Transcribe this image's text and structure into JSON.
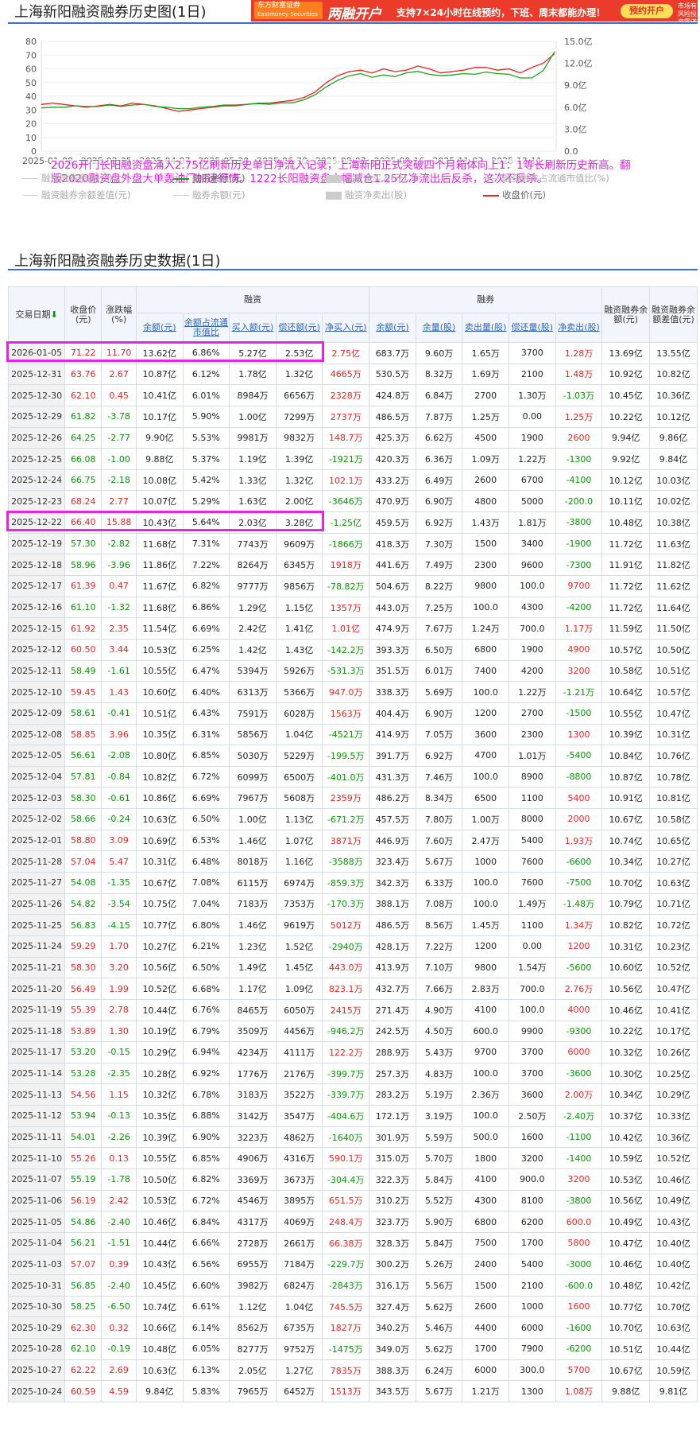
{
  "title": "上海新阳融资融券历史图(1日)",
  "ad": {
    "logo": "东方财富证券",
    "logo_sub": "Eastmoney Securities",
    "big": "两融开户",
    "text": "支持7×24小时在线预约，下班、周末都能办理！",
    "button": "预约开户",
    "mini": "市场有风险投资需谨慎"
  },
  "annotation": "2026开门长阳融资盘涌入2.75亿刷新历史单日净流入记录，上海新阳正式突破四个月箱体向上1：1等长刷新历史新高。翻版2020融资盘外盘大单轰油门加速行情。1222长阳融资盘大幅减仓1.25亿净流出后反杀，这次不反杀。",
  "section_title": "上海新阳融资融券历史数据(1日)",
  "legend": [
    "融资融券余额(元)",
    "融资余额(元)",
    "融资净买入(元)",
    "融资融券占流通市值比(%)",
    "融资融券余额差值(元)",
    "融券余额(元)",
    "融资净卖出(股)",
    "收盘价(元)"
  ],
  "headers": {
    "date": "交易日期",
    "close": "收盘价(元)",
    "chg": "涨跌幅(%)",
    "rz": "融资",
    "rq": "融券",
    "rzrq": "融资融券余额(元)",
    "diff": "融资融券余额差值(元)",
    "rz_bal": "余额(元)",
    "rz_pct": "余额占流通市值比",
    "rz_buy": "买入额(元)",
    "rz_repay": "偿还额(元)",
    "rz_net": "净买入(元)",
    "rq_bal": "余额(元)",
    "rq_vol": "余量(股)",
    "rq_sell": "卖出量(股)",
    "rq_repay": "偿还量(股)",
    "rq_net": "净卖出(股)"
  },
  "rows": [
    [
      "2026-01-05",
      "71.22",
      "11.70",
      "13.62亿",
      "6.86%",
      "5.27亿",
      "2.53亿",
      "2.75亿",
      "683.7万",
      "9.60万",
      "1.65万",
      "3700",
      "1.28万",
      "13.69亿",
      "13.55亿"
    ],
    [
      "2025-12-31",
      "63.76",
      "2.67",
      "10.87亿",
      "6.12%",
      "1.78亿",
      "1.32亿",
      "4665万",
      "530.5万",
      "8.32万",
      "1.69万",
      "2100",
      "1.48万",
      "10.92亿",
      "10.82亿"
    ],
    [
      "2025-12-30",
      "62.10",
      "0.45",
      "10.41亿",
      "6.01%",
      "8984万",
      "6656万",
      "2328万",
      "424.8万",
      "6.84万",
      "2700",
      "1.30万",
      "-1.03万",
      "10.45亿",
      "10.36亿"
    ],
    [
      "2025-12-29",
      "61.82",
      "-3.78",
      "10.17亿",
      "5.90%",
      "1.00亿",
      "7299万",
      "2737万",
      "486.5万",
      "7.87万",
      "1.25万",
      "0.00",
      "1.25万",
      "10.22亿",
      "10.12亿"
    ],
    [
      "2025-12-26",
      "64.25",
      "-2.77",
      "9.90亿",
      "5.53%",
      "9981万",
      "9832万",
      "148.7万",
      "425.3万",
      "6.62万",
      "4500",
      "1900",
      "2600",
      "9.94亿",
      "9.86亿"
    ],
    [
      "2025-12-25",
      "66.08",
      "-1.00",
      "9.88亿",
      "5.37%",
      "1.19亿",
      "1.39亿",
      "-1921万",
      "420.3万",
      "6.36万",
      "1.09万",
      "1.22万",
      "-1300",
      "9.92亿",
      "9.84亿"
    ],
    [
      "2025-12-24",
      "66.75",
      "-2.18",
      "10.08亿",
      "5.42%",
      "1.33亿",
      "1.32亿",
      "102.1万",
      "433.2万",
      "6.49万",
      "2600",
      "6700",
      "-4100",
      "10.12亿",
      "10.03亿"
    ],
    [
      "2025-12-23",
      "68.24",
      "2.77",
      "10.07亿",
      "5.29%",
      "1.63亿",
      "2.00亿",
      "-3646万",
      "470.9万",
      "6.90万",
      "4800",
      "5000",
      "-200.0",
      "10.11亿",
      "10.02亿"
    ],
    [
      "2025-12-22",
      "66.40",
      "15.88",
      "10.43亿",
      "5.64%",
      "2.03亿",
      "3.28亿",
      "-1.25亿",
      "459.5万",
      "6.92万",
      "1.43万",
      "1.81万",
      "-3800",
      "10.48亿",
      "10.38亿"
    ],
    [
      "2025-12-19",
      "57.30",
      "-2.82",
      "11.68亿",
      "7.31%",
      "7743万",
      "9609万",
      "-1866万",
      "418.3万",
      "7.30万",
      "1500",
      "3400",
      "-1900",
      "11.72亿",
      "11.63亿"
    ],
    [
      "2025-12-18",
      "58.96",
      "-3.96",
      "11.86亿",
      "7.22%",
      "8264万",
      "6345万",
      "1918万",
      "441.6万",
      "7.49万",
      "2300",
      "9600",
      "-7300",
      "11.91亿",
      "11.82亿"
    ],
    [
      "2025-12-17",
      "61.39",
      "0.47",
      "11.67亿",
      "6.82%",
      "9777万",
      "9856万",
      "-78.82万",
      "504.6万",
      "8.22万",
      "9800",
      "100.0",
      "9700",
      "11.72亿",
      "11.62亿"
    ],
    [
      "2025-12-16",
      "61.10",
      "-1.32",
      "11.68亿",
      "6.86%",
      "1.29亿",
      "1.15亿",
      "1357万",
      "443.0万",
      "7.25万",
      "100.0",
      "4300",
      "-4200",
      "11.72亿",
      "11.64亿"
    ],
    [
      "2025-12-15",
      "61.92",
      "2.35",
      "11.54亿",
      "6.69%",
      "2.42亿",
      "1.41亿",
      "1.01亿",
      "474.9万",
      "7.67万",
      "1.24万",
      "700.0",
      "1.17万",
      "11.59亿",
      "11.50亿"
    ],
    [
      "2025-12-12",
      "60.50",
      "3.44",
      "10.53亿",
      "6.25%",
      "1.42亿",
      "1.43亿",
      "-142.2万",
      "393.3万",
      "6.50万",
      "6800",
      "1900",
      "4900",
      "10.57亿",
      "10.50亿"
    ],
    [
      "2025-12-11",
      "58.49",
      "-1.61",
      "10.55亿",
      "6.47%",
      "5394万",
      "5926万",
      "-531.3万",
      "351.5万",
      "6.01万",
      "7400",
      "4200",
      "3200",
      "10.58亿",
      "10.51亿"
    ],
    [
      "2025-12-10",
      "59.45",
      "1.43",
      "10.60亿",
      "6.40%",
      "6313万",
      "5366万",
      "947.0万",
      "338.3万",
      "5.69万",
      "100.0",
      "1.22万",
      "-1.21万",
      "10.64亿",
      "10.57亿"
    ],
    [
      "2025-12-09",
      "58.61",
      "-0.41",
      "10.51亿",
      "6.43%",
      "7591万",
      "6028万",
      "1563万",
      "404.4万",
      "6.90万",
      "1200",
      "2700",
      "-1500",
      "10.55亿",
      "10.47亿"
    ],
    [
      "2025-12-08",
      "58.85",
      "3.96",
      "10.35亿",
      "6.31%",
      "5856万",
      "1.04亿",
      "-4521万",
      "414.9万",
      "7.05万",
      "3600",
      "2300",
      "1300",
      "10.39亿",
      "10.31亿"
    ],
    [
      "2025-12-05",
      "56.61",
      "-2.08",
      "10.80亿",
      "6.85%",
      "5030万",
      "5229万",
      "-199.5万",
      "391.7万",
      "6.92万",
      "4700",
      "1.01万",
      "-5400",
      "10.84亿",
      "10.76亿"
    ],
    [
      "2025-12-04",
      "57.81",
      "-0.84",
      "10.82亿",
      "6.72%",
      "6099万",
      "6500万",
      "-401.0万",
      "431.3万",
      "7.46万",
      "100.0",
      "8900",
      "-8800",
      "10.87亿",
      "10.78亿"
    ],
    [
      "2025-12-03",
      "58.30",
      "-0.61",
      "10.86亿",
      "6.69%",
      "7967万",
      "5608万",
      "2359万",
      "486.2万",
      "8.34万",
      "6500",
      "1100",
      "5400",
      "10.91亿",
      "10.81亿"
    ],
    [
      "2025-12-02",
      "58.66",
      "-0.24",
      "10.63亿",
      "6.50%",
      "1.00亿",
      "1.13亿",
      "-671.2万",
      "457.5万",
      "7.80万",
      "1.00万",
      "8000",
      "2000",
      "10.67亿",
      "10.58亿"
    ],
    [
      "2025-12-01",
      "58.80",
      "3.09",
      "10.69亿",
      "6.53%",
      "1.46亿",
      "1.07亿",
      "3871万",
      "446.9万",
      "7.60万",
      "2.47万",
      "5400",
      "1.93万",
      "10.74亿",
      "10.65亿"
    ],
    [
      "2025-11-28",
      "57.04",
      "5.47",
      "10.31亿",
      "6.48%",
      "8018万",
      "1.16亿",
      "-3588万",
      "323.4万",
      "5.67万",
      "1000",
      "7600",
      "-6600",
      "10.34亿",
      "10.27亿"
    ],
    [
      "2025-11-27",
      "54.08",
      "-1.35",
      "10.67亿",
      "7.08%",
      "6115万",
      "6974万",
      "-859.3万",
      "342.3万",
      "6.33万",
      "100.0",
      "7600",
      "-7500",
      "10.70亿",
      "10.63亿"
    ],
    [
      "2025-11-26",
      "54.82",
      "-3.54",
      "10.75亿",
      "7.04%",
      "7183万",
      "7353万",
      "-170.3万",
      "388.1万",
      "7.08万",
      "100.0",
      "1.49万",
      "-1.48万",
      "10.79亿",
      "10.71亿"
    ],
    [
      "2025-11-25",
      "56.83",
      "-4.15",
      "10.77亿",
      "6.80%",
      "1.46亿",
      "9619万",
      "5012万",
      "486.5万",
      "8.56万",
      "1.45万",
      "1100",
      "1.34万",
      "10.82亿",
      "10.72亿"
    ],
    [
      "2025-11-24",
      "59.29",
      "1.70",
      "10.27亿",
      "6.21%",
      "1.23亿",
      "1.52亿",
      "-2940万",
      "428.1万",
      "7.22万",
      "1200",
      "0.00",
      "1200",
      "10.31亿",
      "10.23亿"
    ],
    [
      "2025-11-21",
      "58.30",
      "3.20",
      "10.56亿",
      "6.50%",
      "1.49亿",
      "1.45亿",
      "443.0万",
      "413.9万",
      "7.10万",
      "9800",
      "1.54万",
      "-5600",
      "10.60亿",
      "10.52亿"
    ],
    [
      "2025-11-20",
      "56.49",
      "1.99",
      "10.52亿",
      "6.68%",
      "1.17亿",
      "1.09亿",
      "823.1万",
      "432.7万",
      "7.66万",
      "2.83万",
      "700.0",
      "2.76万",
      "10.56亿",
      "10.47亿"
    ],
    [
      "2025-11-19",
      "55.39",
      "2.78",
      "10.44亿",
      "6.76%",
      "8465万",
      "6050万",
      "2415万",
      "271.4万",
      "4.90万",
      "4100",
      "100.0",
      "4000",
      "10.46亿",
      "10.41亿"
    ],
    [
      "2025-11-18",
      "53.89",
      "1.30",
      "10.19亿",
      "6.79%",
      "3509万",
      "4456万",
      "-946.2万",
      "242.5万",
      "4.50万",
      "600.0",
      "9900",
      "-9300",
      "10.22亿",
      "10.17亿"
    ],
    [
      "2025-11-17",
      "53.20",
      "-0.15",
      "10.29亿",
      "6.94%",
      "4234万",
      "4111万",
      "122.2万",
      "288.9万",
      "5.43万",
      "9700",
      "3700",
      "6000",
      "10.32亿",
      "10.26亿"
    ],
    [
      "2025-11-14",
      "53.28",
      "-2.35",
      "10.28亿",
      "6.92%",
      "1776万",
      "2176万",
      "-399.7万",
      "257.3万",
      "4.83万",
      "100.0",
      "3700",
      "-3600",
      "10.30亿",
      "10.25亿"
    ],
    [
      "2025-11-13",
      "54.56",
      "1.15",
      "10.32亿",
      "6.78%",
      "3183万",
      "3522万",
      "-339.7万",
      "283.2万",
      "5.19万",
      "2.36万",
      "3600",
      "2.00万",
      "10.34亿",
      "10.29亿"
    ],
    [
      "2025-11-12",
      "53.94",
      "-0.13",
      "10.35亿",
      "6.88%",
      "3142万",
      "3547万",
      "-404.6万",
      "172.1万",
      "3.19万",
      "100.0",
      "2.50万",
      "-2.40万",
      "10.37亿",
      "10.33亿"
    ],
    [
      "2025-11-11",
      "54.01",
      "-2.26",
      "10.39亿",
      "6.90%",
      "3223万",
      "4862万",
      "-1640万",
      "301.9万",
      "5.59万",
      "500.0",
      "1600",
      "-1100",
      "10.42亿",
      "10.36亿"
    ],
    [
      "2025-11-10",
      "55.26",
      "0.13",
      "10.55亿",
      "6.85%",
      "4906万",
      "4316万",
      "590.1万",
      "315.0万",
      "5.70万",
      "1800",
      "3200",
      "-1400",
      "10.59亿",
      "10.52亿"
    ],
    [
      "2025-11-07",
      "55.19",
      "-1.78",
      "10.50亿",
      "6.82%",
      "3369万",
      "3673万",
      "-304.4万",
      "322.3万",
      "5.84万",
      "4100",
      "900.0",
      "3200",
      "10.53亿",
      "10.46亿"
    ],
    [
      "2025-11-06",
      "56.19",
      "2.42",
      "10.53亿",
      "6.72%",
      "4546万",
      "3895万",
      "651.5万",
      "310.2万",
      "5.52万",
      "4300",
      "8100",
      "-3800",
      "10.56亿",
      "10.49亿"
    ],
    [
      "2025-11-05",
      "54.86",
      "-2.40",
      "10.46亿",
      "6.84%",
      "4317万",
      "4069万",
      "248.4万",
      "323.7万",
      "5.90万",
      "6800",
      "6200",
      "600.0",
      "10.49亿",
      "10.43亿"
    ],
    [
      "2025-11-04",
      "56.21",
      "-1.51",
      "10.44亿",
      "6.66%",
      "2728万",
      "2661万",
      "66.38万",
      "328.3万",
      "5.84万",
      "7500",
      "1700",
      "5800",
      "10.47亿",
      "10.40亿"
    ],
    [
      "2025-11-03",
      "57.07",
      "0.39",
      "10.43亿",
      "6.56%",
      "6955万",
      "7184万",
      "-229.7万",
      "300.2万",
      "5.26万",
      "2400",
      "5400",
      "-3000",
      "10.46亿",
      "10.40亿"
    ],
    [
      "2025-10-31",
      "56.85",
      "-2.40",
      "10.45亿",
      "6.60%",
      "3982万",
      "6824万",
      "-2843万",
      "316.1万",
      "5.56万",
      "1500",
      "2100",
      "-600.0",
      "10.48亿",
      "10.42亿"
    ],
    [
      "2025-10-30",
      "58.25",
      "-6.50",
      "10.74亿",
      "6.61%",
      "1.12亿",
      "1.04亿",
      "745.5万",
      "327.4万",
      "5.62万",
      "2600",
      "1000",
      "1600",
      "10.77亿",
      "10.70亿"
    ],
    [
      "2025-10-29",
      "62.30",
      "0.32",
      "10.66亿",
      "6.14%",
      "8562万",
      "6735万",
      "1827万",
      "340.2万",
      "5.46万",
      "4400",
      "6000",
      "-1600",
      "10.70亿",
      "10.63亿"
    ],
    [
      "2025-10-28",
      "62.10",
      "-0.19",
      "10.48亿",
      "6.05%",
      "8277万",
      "9752万",
      "-1475万",
      "349.0万",
      "5.62万",
      "1700",
      "7900",
      "-6200",
      "10.51亿",
      "10.44亿"
    ],
    [
      "2025-10-27",
      "62.22",
      "2.69",
      "10.63亿",
      "6.13%",
      "2.05亿",
      "1.27亿",
      "7835万",
      "388.3万",
      "6.24万",
      "6000",
      "300.0",
      "5700",
      "10.67亿",
      "10.59亿"
    ],
    [
      "2025-10-24",
      "60.59",
      "4.59",
      "9.84亿",
      "5.83%",
      "7965万",
      "6452万",
      "1513万",
      "343.5万",
      "5.67万",
      "1.21万",
      "1300",
      "1.08万",
      "9.88亿",
      "9.81亿"
    ]
  ],
  "chart_data": {
    "type": "line",
    "x": [
      "2025-01-08",
      "2025-02-25",
      "2025-04-07",
      "2025-05-20",
      "2025-06-30",
      "2025-08-07",
      "2025-09-16",
      "2025-11-03",
      "2025-12-11"
    ],
    "y_left": {
      "ticks": [
        "0",
        "10",
        "20",
        "30",
        "40",
        "50",
        "60",
        "70",
        "80"
      ],
      "range": [
        0,
        80
      ]
    },
    "y_right": {
      "ticks": [
        "0.0",
        "3.0亿",
        "6.0亿",
        "9.0亿",
        "12.0亿",
        "15.0亿"
      ],
      "range": [
        0,
        15
      ]
    },
    "series": [
      {
        "name": "收盘价(元)",
        "color": "#e82020",
        "values": [
          34,
          35,
          34,
          33,
          32,
          33,
          34,
          33,
          35,
          34,
          33,
          31,
          29,
          30,
          31,
          32,
          33,
          33,
          34,
          35,
          35,
          36,
          37,
          39,
          43,
          50,
          55,
          58,
          59,
          57,
          60,
          58,
          59,
          62,
          60,
          57,
          58,
          59,
          61,
          61,
          59,
          60,
          57,
          61,
          64,
          71
        ]
      },
      {
        "name": "融资余额(元)",
        "color": "#1aa31a",
        "values": [
          5.9,
          6.0,
          6.0,
          6.2,
          6.1,
          6.1,
          6.3,
          6.1,
          6.3,
          6.4,
          6.1,
          6.0,
          5.8,
          5.8,
          6.0,
          6.1,
          6.3,
          6.3,
          6.4,
          6.5,
          6.4,
          6.6,
          6.6,
          7.0,
          7.7,
          8.8,
          9.7,
          10.3,
          10.6,
          10.1,
          10.4,
          10.2,
          10.7,
          10.9,
          10.5,
          10.3,
          10.4,
          10.6,
          10.5,
          10.8,
          10.6,
          10.5,
          10.0,
          10.0,
          11.0,
          13.6
        ]
      }
    ]
  }
}
